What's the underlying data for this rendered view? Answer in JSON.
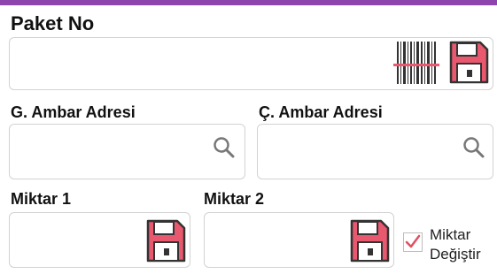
{
  "colors": {
    "accent_bar": "#8e44ad",
    "save_icon": "#e8586e",
    "check_mark": "#e05060"
  },
  "package": {
    "label": "Paket No",
    "value": "",
    "barcode_icon": "barcode-scan-icon",
    "save_icon": "floppy-disk-icon"
  },
  "source_location": {
    "label": "G. Ambar Adresi",
    "value": "",
    "search_icon": "magnifier-icon"
  },
  "target_location": {
    "label": "Ç. Ambar Adresi",
    "value": "",
    "search_icon": "magnifier-icon"
  },
  "quantity1": {
    "label": "Miktar 1",
    "value": "",
    "save_icon": "floppy-disk-icon"
  },
  "quantity2": {
    "label": "Miktar 2",
    "value": "",
    "save_icon": "floppy-disk-icon"
  },
  "change_quantity": {
    "label_line1": "Miktar",
    "label_line2": "Değiştir",
    "checked": true
  }
}
